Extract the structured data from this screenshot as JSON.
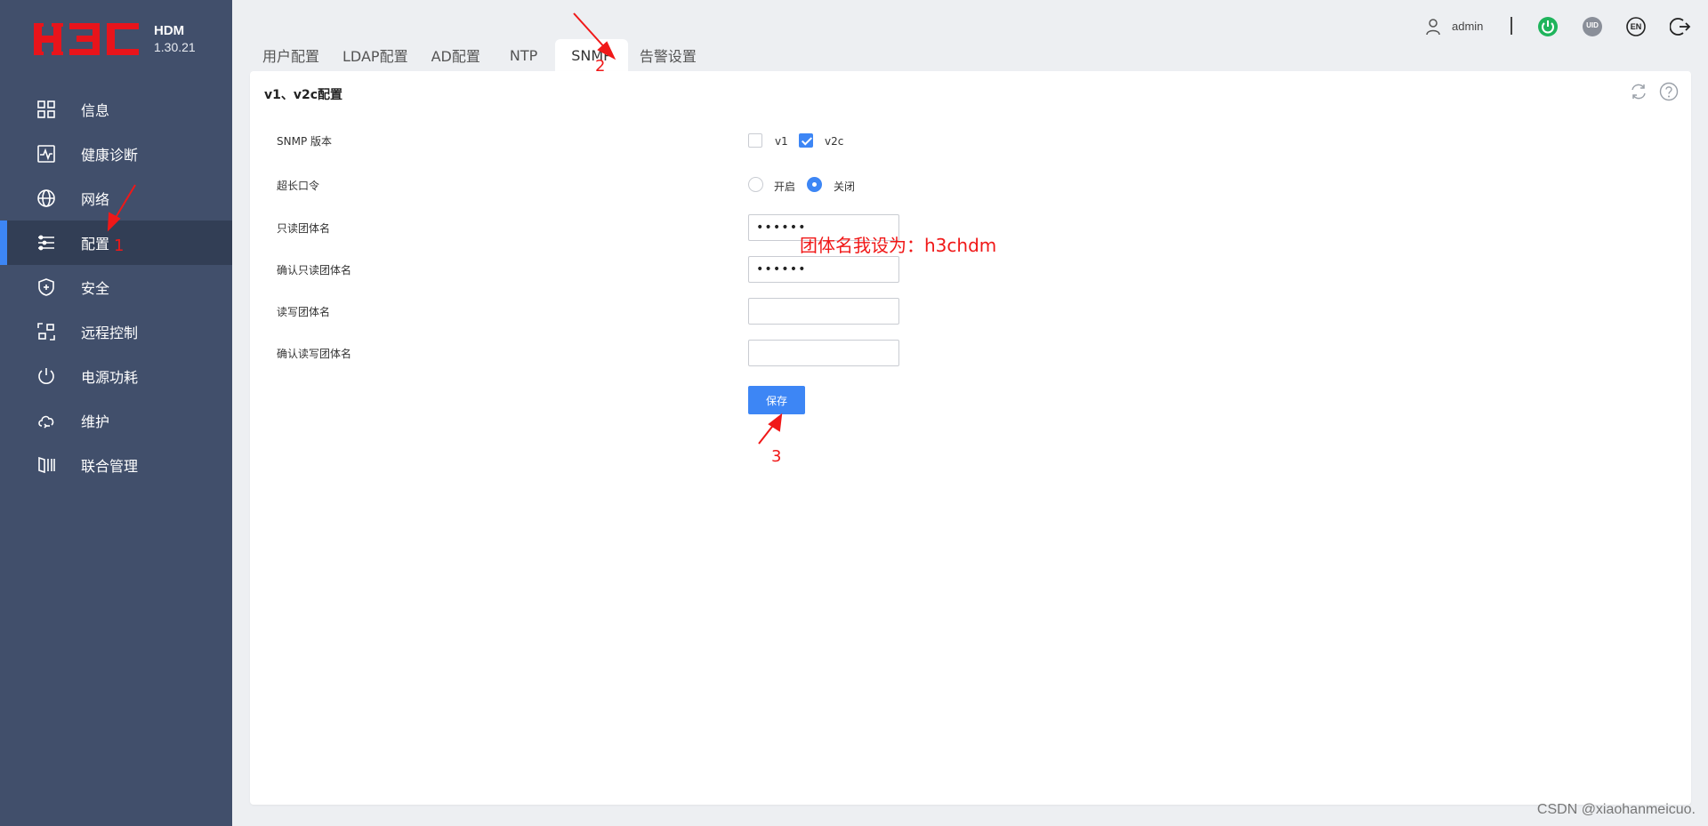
{
  "brand": {
    "logo_text": "H3C",
    "product": "HDM",
    "version": "1.30.21"
  },
  "sidebar": {
    "items": [
      {
        "label": "信息",
        "icon": "grid-icon",
        "active": false
      },
      {
        "label": "健康诊断",
        "icon": "pulse-icon",
        "active": false
      },
      {
        "label": "网络",
        "icon": "globe-icon",
        "active": false
      },
      {
        "label": "配置",
        "icon": "sliders-icon",
        "active": true
      },
      {
        "label": "安全",
        "icon": "shield-plus-icon",
        "active": false
      },
      {
        "label": "远程控制",
        "icon": "remote-icon",
        "active": false
      },
      {
        "label": "电源功耗",
        "icon": "power-icon",
        "active": false
      },
      {
        "label": "维护",
        "icon": "cloud-sync-icon",
        "active": false
      },
      {
        "label": "联合管理",
        "icon": "server-rack-icon",
        "active": false
      }
    ]
  },
  "tabs": [
    {
      "label": "用户配置",
      "active": false
    },
    {
      "label": "LDAP配置",
      "active": false
    },
    {
      "label": "AD配置",
      "active": false
    },
    {
      "label": "NTP",
      "active": false
    },
    {
      "label": "SNMP",
      "active": true
    },
    {
      "label": "告警设置",
      "active": false
    }
  ],
  "topbar": {
    "user": "admin",
    "icons": [
      "power-status-icon",
      "uid-icon",
      "language-en-icon",
      "logout-icon"
    ],
    "uid_text": "UID",
    "en_text": "EN",
    "colors": {
      "power": "#1fb45c",
      "uid": "#8a8f99"
    }
  },
  "panel": {
    "title": "v1、v2c配置",
    "fields": {
      "snmp_version_label": "SNMP 版本",
      "v1_label": "v1",
      "v1_checked": false,
      "v2c_label": "v2c",
      "v2c_checked": true,
      "long_password_label": "超长口令",
      "enable_label": "开启",
      "enable_selected": false,
      "disable_label": "关闭",
      "disable_selected": true,
      "ro_community_label": "只读团体名",
      "ro_community_value": "••••••",
      "ro_confirm_label": "确认只读团体名",
      "ro_confirm_value": "••••••",
      "rw_community_label": "读写团体名",
      "rw_community_value": "",
      "rw_confirm_label": "确认读写团体名",
      "rw_confirm_value": ""
    },
    "save_label": "保存"
  },
  "annotations": {
    "step1": "1",
    "step2": "2",
    "step3": "3",
    "note": "团体名我设为：h3chdm",
    "color": "#f01818"
  },
  "watermark": "CSDN @xiaohanmeicuo."
}
